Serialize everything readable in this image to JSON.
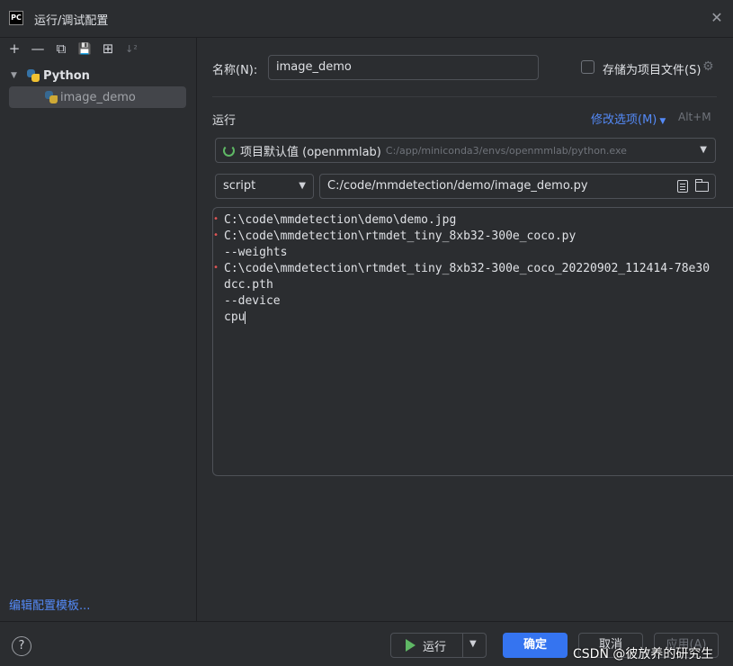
{
  "window": {
    "logo_text": "PC",
    "title": "运行/调试配置",
    "close_glyph": "✕"
  },
  "sidebar": {
    "toolbar_icons": [
      "add-icon",
      "remove-icon",
      "copy-icon",
      "save-icon",
      "new-folder-icon",
      "sort-icon"
    ],
    "toolbar_glyphs": [
      "+",
      "—",
      "⧉",
      "💾",
      "⊞",
      "↓²"
    ],
    "group_label": "Python",
    "item_label": "image_demo",
    "edit_templates": "编辑配置模板..."
  },
  "form": {
    "name_label": "名称(N):",
    "name_value": "image_demo",
    "store_label": "存储为项目文件(S)",
    "store_checked": false,
    "run_section": "运行",
    "modify_options": "修改选项(M)",
    "modify_shortcut": "Alt+M",
    "interpreter_name": "项目默认值 (openmmlab)",
    "interpreter_path": "C:/app/miniconda3/envs/openmmlab/python.exe",
    "script_type": "script",
    "script_path": "C:/code/mmdetection/demo/image_demo.py"
  },
  "params": {
    "lines": [
      {
        "text": "C:\\code\\mmdetection\\demo\\demo.jpg",
        "marked": true
      },
      {
        "text": "C:\\code\\mmdetection\\rtmdet_tiny_8xb32-300e_coco.py",
        "marked": true
      },
      {
        "text": "--weights",
        "marked": false
      },
      {
        "text": "C:\\code\\mmdetection\\rtmdet_tiny_8xb32-300e_coco_20220902_112414-78e30",
        "marked": true
      },
      {
        "text": "dcc.pth",
        "marked": false
      },
      {
        "text": "--device",
        "marked": false
      },
      {
        "text": "cpu",
        "marked": false
      }
    ]
  },
  "footer": {
    "help": "?",
    "run_label": "运行",
    "ok_label": "确定",
    "cancel_label": "取消",
    "apply_label": "应用(A)",
    "watermark": "CSDN @彼放养的研究生"
  },
  "colors": {
    "accent": "#3574f0",
    "link": "#548af7",
    "run_green": "#5fb865",
    "marker_red": "#e05555",
    "background": "#2b2d30"
  }
}
